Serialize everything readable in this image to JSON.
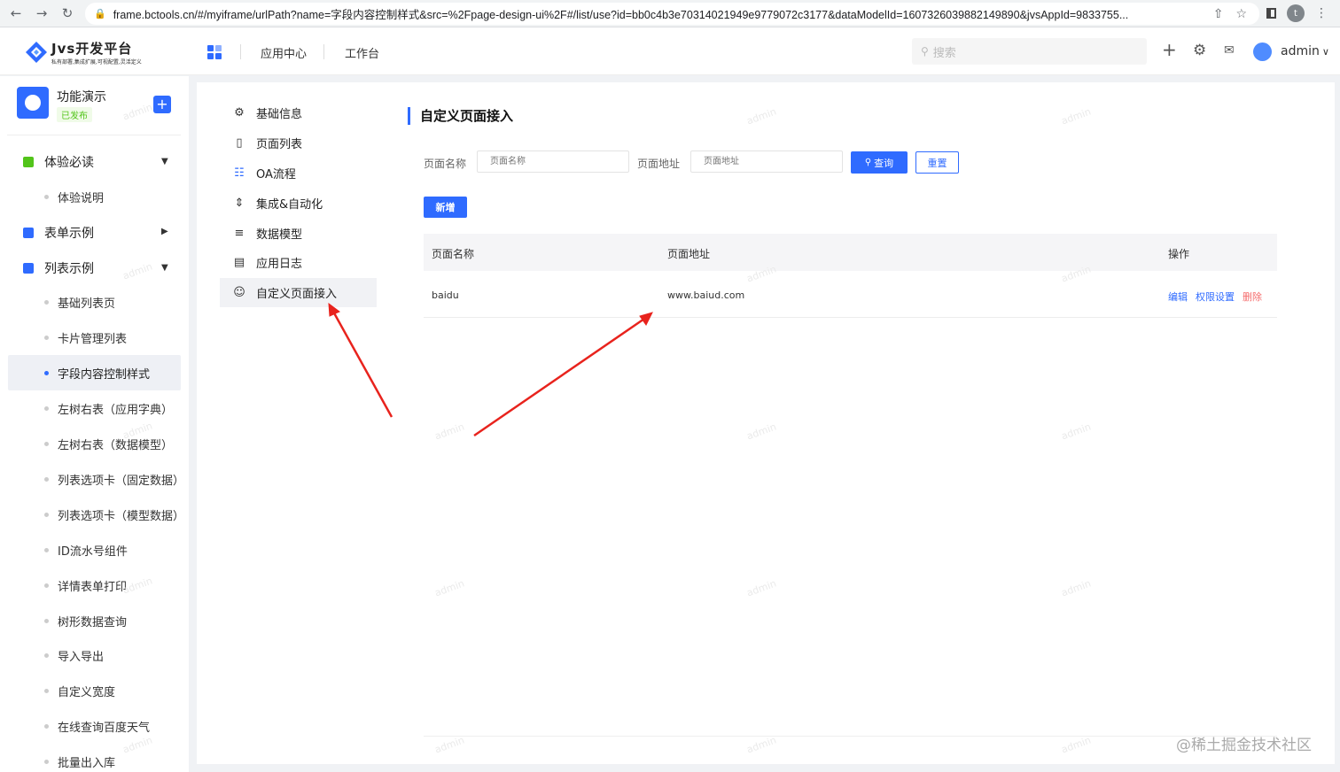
{
  "browser": {
    "url": "frame.bctools.cn/#/myiframe/urlPath?name=字段内容控制样式&src=%2Fpage-design-ui%2F#/list/use?id=bb0c4b3e70314021949e9779072c3177&dataModelId=1607326039882149890&jvsAppId=9833755...",
    "profile_initial": "t"
  },
  "header": {
    "logo_title": "Jvs开发平台",
    "logo_subtitle": "私有部署,集成扩展,可视配置,灵活定义",
    "nav": [
      "应用中心",
      "工作台"
    ],
    "search_placeholder": "搜索",
    "username": "admin"
  },
  "sidebar": {
    "app_name": "功能演示",
    "app_status": "已发布",
    "groups": [
      {
        "label": "体验必读",
        "color": "#52c41a",
        "expanded": true
      },
      {
        "label": "表单示例",
        "color": "#2f6bff",
        "expanded": false
      },
      {
        "label": "列表示例",
        "color": "#2f6bff",
        "expanded": true
      }
    ],
    "items": [
      "体验说明",
      "基础列表页",
      "卡片管理列表",
      "字段内容控制样式",
      "左树右表（应用字典）",
      "左树右表（数据模型）",
      "列表选项卡（固定数据）",
      "列表选项卡（模型数据）",
      "ID流水号组件",
      "详情表单打印",
      "树形数据查询",
      "导入导出",
      "自定义宽度",
      "在线查询百度天气",
      "批量出入库"
    ],
    "active_item": "字段内容控制样式"
  },
  "submenu": {
    "items": [
      {
        "label": "基础信息",
        "icon": "gear-icon"
      },
      {
        "label": "页面列表",
        "icon": "page-icon"
      },
      {
        "label": "OA流程",
        "icon": "flow-icon"
      },
      {
        "label": "集成&自动化",
        "icon": "sliders-icon"
      },
      {
        "label": "数据模型",
        "icon": "layers-icon"
      },
      {
        "label": "应用日志",
        "icon": "log-icon"
      },
      {
        "label": "自定义页面接入",
        "icon": "smile-icon"
      }
    ],
    "active": "自定义页面接入"
  },
  "content": {
    "heading": "自定义页面接入",
    "filters": [
      {
        "label": "页面名称",
        "placeholder": "页面名称"
      },
      {
        "label": "页面地址",
        "placeholder": "页面地址"
      }
    ],
    "query_button": "查询",
    "reset_button": "重置",
    "add_button": "新增",
    "table": {
      "columns": [
        "页面名称",
        "页面地址",
        "操作"
      ],
      "rows": [
        {
          "name": "baidu",
          "url": "www.baiud.com",
          "actions": [
            "编辑",
            "权限设置",
            "删除"
          ]
        }
      ]
    }
  },
  "watermark_text": "admin",
  "corner_watermark": "@稀土掘金技术社区",
  "colors": {
    "accent": "#2f6bff",
    "danger": "#f56c6c",
    "success": "#52c41a",
    "annotation": "#e8231d"
  }
}
